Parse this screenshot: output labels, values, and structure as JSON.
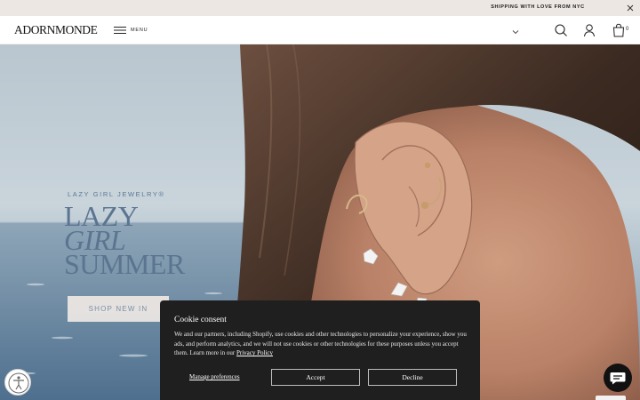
{
  "announcement": {
    "text": "SHIPPING WITH LOVE FROM NYC"
  },
  "header": {
    "logo": "ADORNMONDE",
    "menu_label": "MENU",
    "cart_count": "0"
  },
  "hero": {
    "kicker": "LAZY GIRL JEWELRY®",
    "title_line1": "LAZY",
    "title_line2": "GIRL",
    "title_line3": "SUMMER",
    "cta_label": "SHOP NEW IN"
  },
  "cookie": {
    "title": "Cookie consent",
    "body": "We and our partners, including Shopify, use cookies and other technologies to personalize your experience, show you ads, and perform analytics, and we will not use cookies or other technologies for these purposes unless you accept them. Learn more in our",
    "policy_link": "Privacy Policy",
    "manage_label": "Manage preferences",
    "accept_label": "Accept",
    "decline_label": "Decline"
  },
  "icons": {
    "close": "close-icon",
    "menu": "hamburger-icon",
    "chevron": "chevron-down-icon",
    "search": "search-icon",
    "account": "user-icon",
    "cart": "bag-icon",
    "accessibility": "accessibility-icon",
    "chat": "chat-icon"
  },
  "colors": {
    "announcement_bg": "#ece7e3",
    "hero_text": "#5b7591",
    "cookie_bg": "#1f1f1f",
    "chat_bg": "#111111"
  }
}
